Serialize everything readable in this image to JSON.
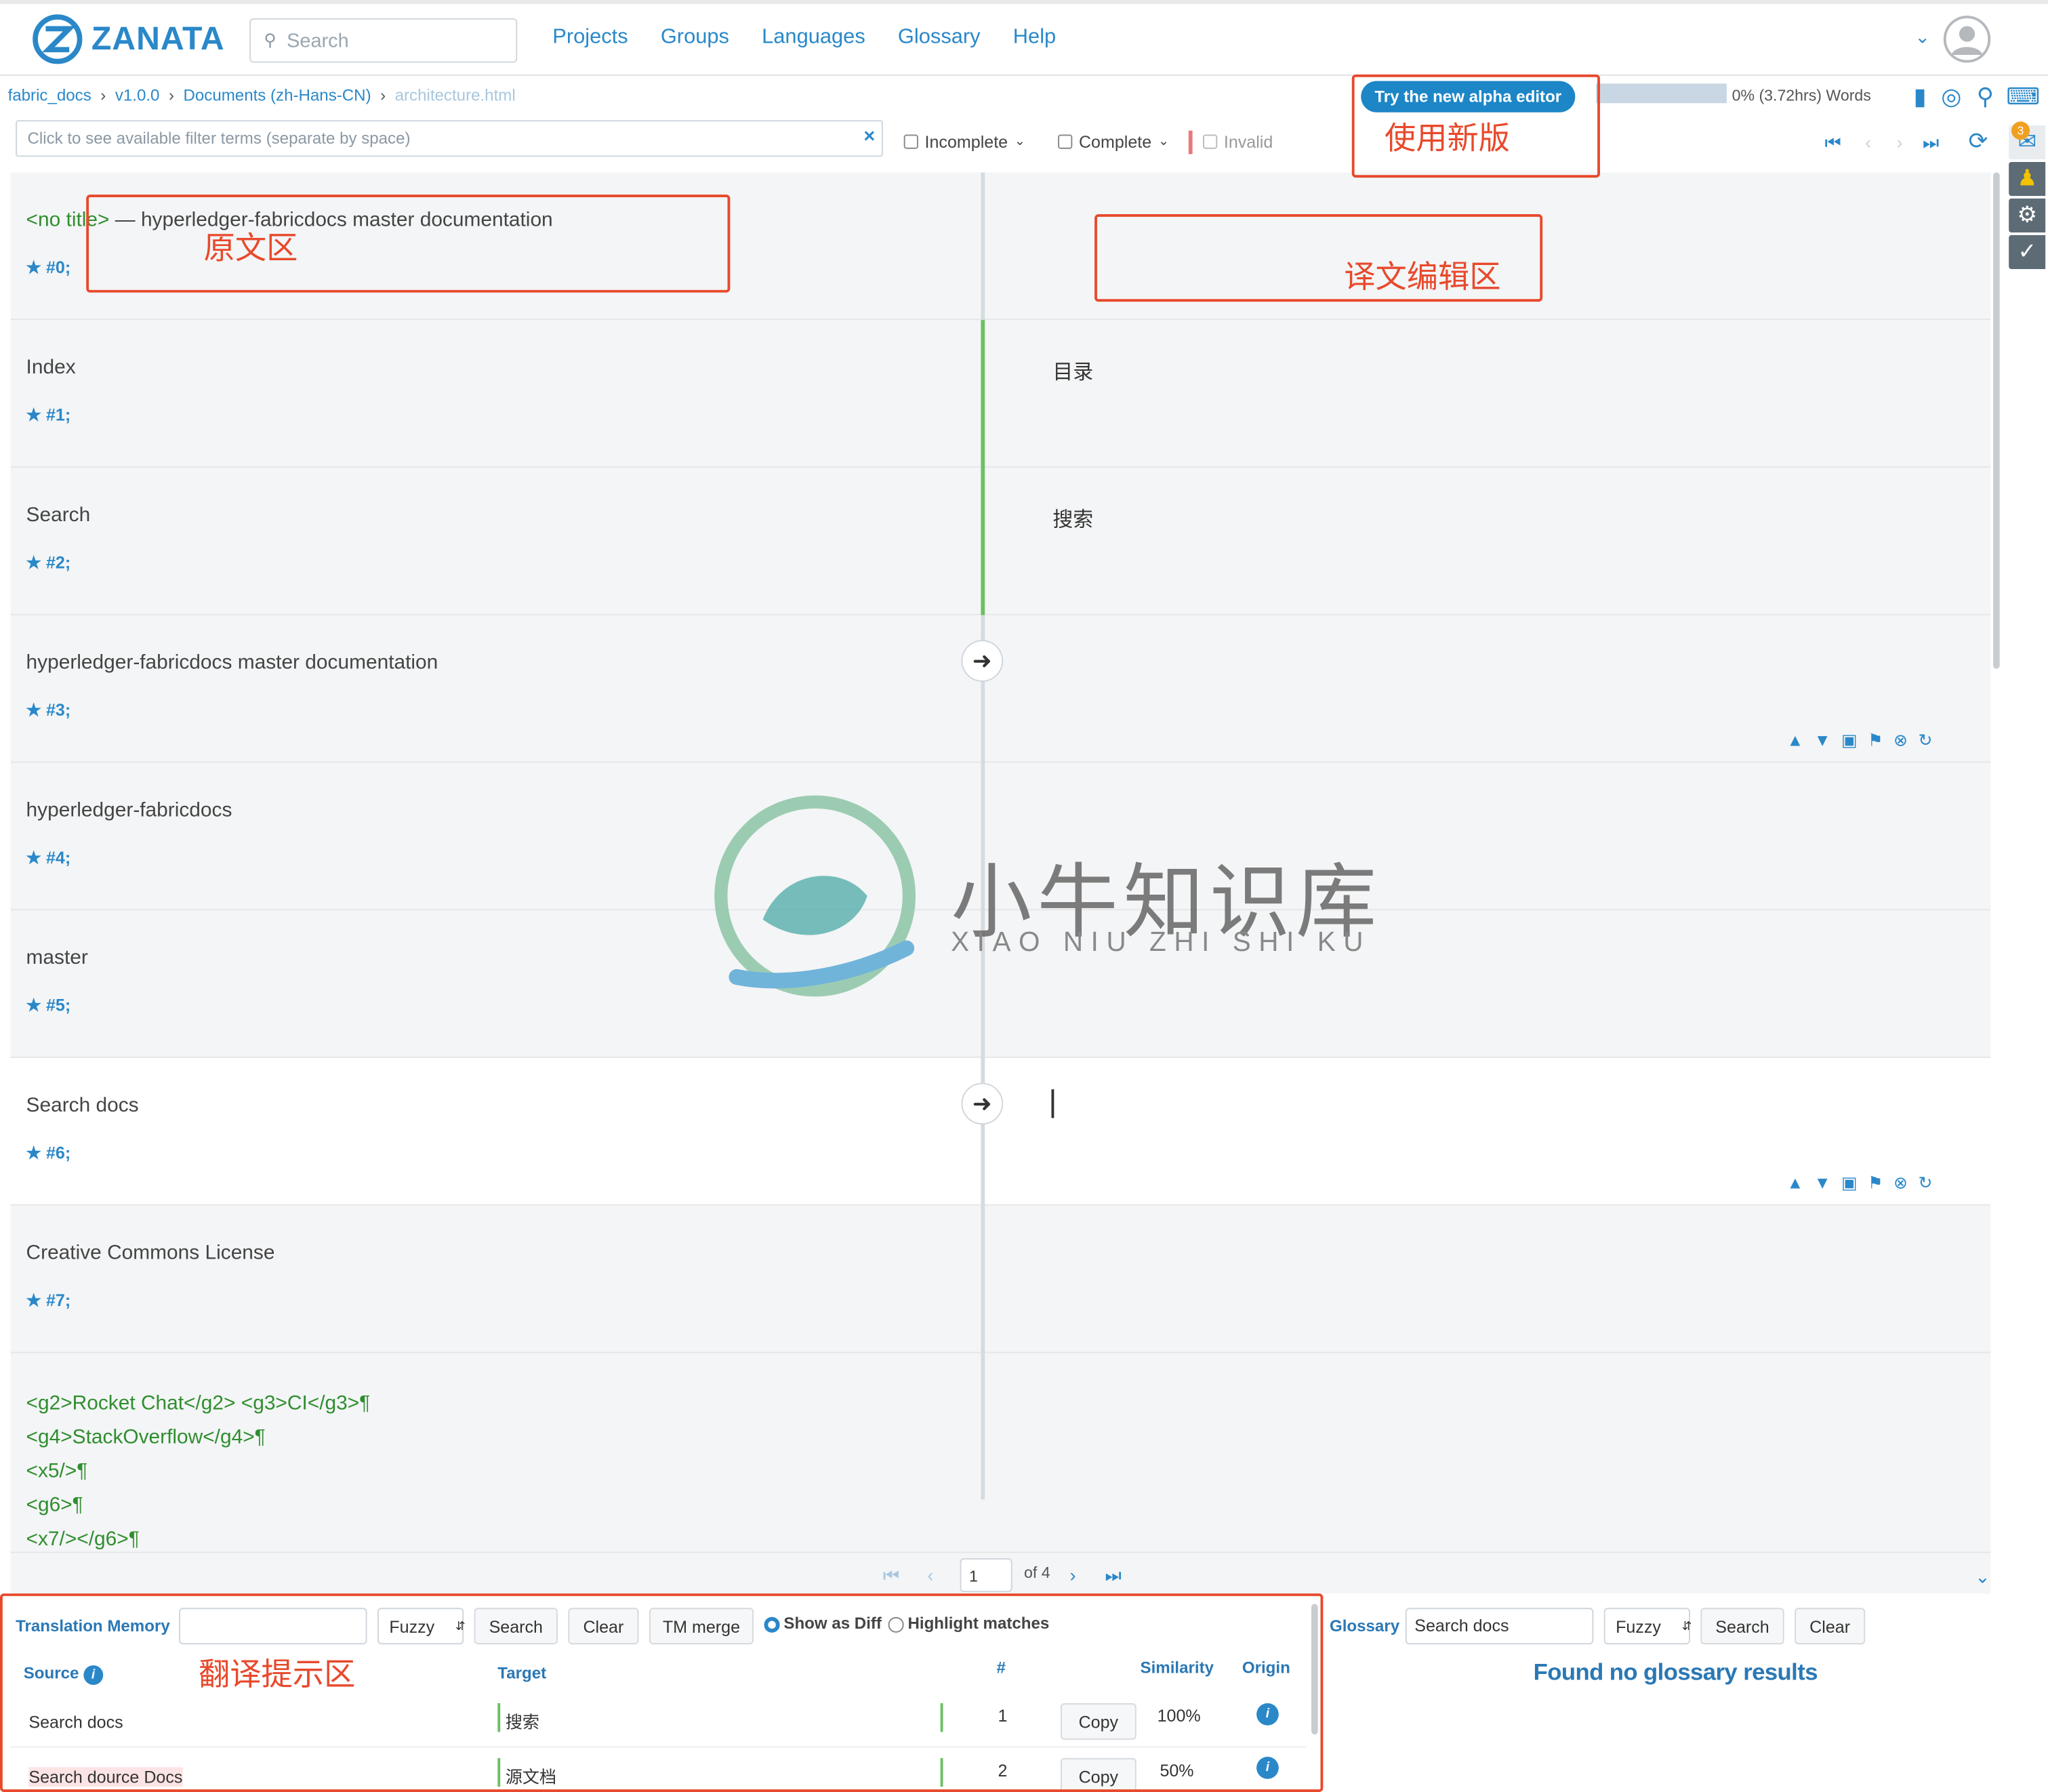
{
  "app": {
    "logo": "ZANATA"
  },
  "header": {
    "search_placeholder": "Search",
    "nav": [
      "Projects",
      "Groups",
      "Languages",
      "Glossary",
      "Help"
    ]
  },
  "breadcrumb": [
    "fabric_docs",
    "v1.0.0",
    "Documents (zh-Hans-CN)",
    "architecture.html"
  ],
  "toolbar": {
    "alpha_button": "Try the new alpha editor",
    "progress_text": "0% (3.72hrs) Words",
    "progress_fraction": 0,
    "notification_count": "3",
    "filter_placeholder": "Click to see available filter terms (separate by space)",
    "filters": [
      "Incomplete",
      "Complete",
      "Invalid"
    ]
  },
  "annotations": {
    "new_version": "使用新版",
    "source_area": "原文区",
    "target_area": "译文编辑区",
    "suggestion_area": "翻译提示区"
  },
  "rows": [
    {
      "source": "<no title> — hyperledger-fabricdocs master documentation",
      "src_tag": "<no title>",
      "src_rest": " — hyperledger-fabricdocs master documentation",
      "id": "#0;",
      "target": ""
    },
    {
      "source": "Index",
      "id": "#1;",
      "target": "目录"
    },
    {
      "source": "Search",
      "id": "#2;",
      "target": "搜索"
    },
    {
      "source": "hyperledger-fabricdocs master documentation",
      "id": "#3;",
      "target": ""
    },
    {
      "source": "hyperledger-fabricdocs",
      "id": "#4;",
      "target": ""
    },
    {
      "source": "master",
      "id": "#5;",
      "target": ""
    },
    {
      "source": "Search docs",
      "id": "#6;",
      "target": ""
    },
    {
      "source": "Creative Commons License",
      "id": "#7;",
      "target": ""
    }
  ],
  "row8_lines": [
    "<g2>Rocket Chat</g2> <g3>CI</g3>¶",
    "<g4>StackOverflow</g4>¶",
    "<x5/>¶",
    "<g6>¶",
    " <x7/></g6>¶"
  ],
  "pager": {
    "page": "1",
    "of": "of 4"
  },
  "watermark": {
    "title": "小牛知识库",
    "subtitle": "XIAO NIU ZHI SHI KU"
  },
  "tm": {
    "label": "Translation Memory",
    "mode": "Fuzzy",
    "search": "Search",
    "clear": "Clear",
    "merge": "TM merge",
    "show_diff": "Show as Diff",
    "highlight": "Highlight matches",
    "columns": {
      "source": "Source",
      "target": "Target",
      "num": "#",
      "similarity": "Similarity",
      "origin": "Origin"
    },
    "copy": "Copy",
    "results": [
      {
        "source": "Search docs",
        "target": "搜索",
        "num": "1",
        "similarity": "100%"
      },
      {
        "source": "Search dource Docs",
        "target": "源文档",
        "num": "2",
        "similarity": "50%"
      }
    ]
  },
  "glossary": {
    "label": "Glossary",
    "query": "Search docs",
    "mode": "Fuzzy",
    "search": "Search",
    "clear": "Clear",
    "empty": "Found no glossary results"
  }
}
